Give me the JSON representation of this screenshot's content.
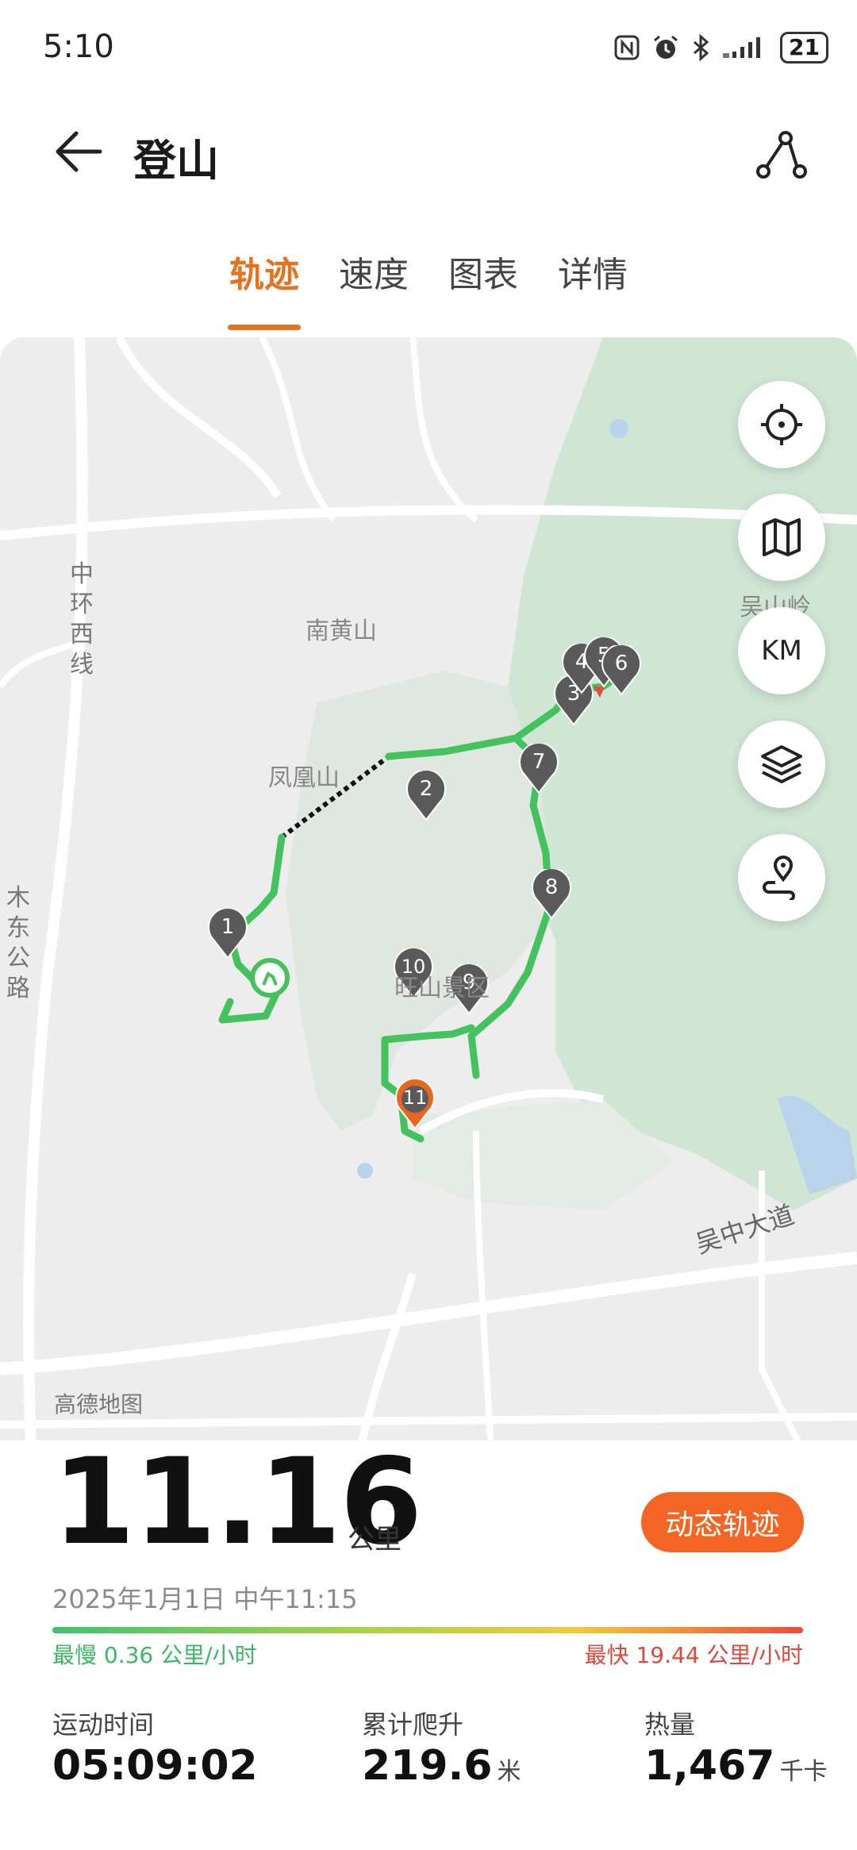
{
  "status_bar": {
    "time": "5:10",
    "battery": "21"
  },
  "header": {
    "title": "登山"
  },
  "tabs": [
    {
      "label": "轨迹",
      "active": true
    },
    {
      "label": "速度",
      "active": false
    },
    {
      "label": "图表",
      "active": false
    },
    {
      "label": "详情",
      "active": false
    }
  ],
  "map": {
    "labels": {
      "nanhuangshan": "南黄山",
      "fenghuangshan": "凤凰山",
      "wangshan": "旺山景区",
      "wushanling": "吴山岭",
      "wuzhong_road": "吴中大道",
      "zhonghuan": "中环西线",
      "mudong": "木东公路"
    },
    "markers": [
      "1",
      "2",
      "3",
      "4",
      "5",
      "6",
      "7",
      "8",
      "9",
      "10",
      "11"
    ],
    "controls": {
      "km_label": "KM"
    },
    "attribution": "高德地图"
  },
  "summary": {
    "distance": "11.16",
    "distance_unit": "公里",
    "dynamic_track_button": "动态轨迹",
    "date": "2025年1月1日 中午11:15",
    "slowest": "最慢 0.36 公里/小时",
    "fastest": "最快 19.44 公里/小时"
  },
  "stats": [
    {
      "label": "运动时间",
      "value": "05:09:02",
      "unit": ""
    },
    {
      "label": "累计爬升",
      "value": "219.6",
      "unit": "米"
    },
    {
      "label": "热量",
      "value": "1,467",
      "unit": "千卡"
    }
  ],
  "colors": {
    "accent": "#e8711e",
    "track": "#43c25d",
    "button": "#f26522"
  }
}
